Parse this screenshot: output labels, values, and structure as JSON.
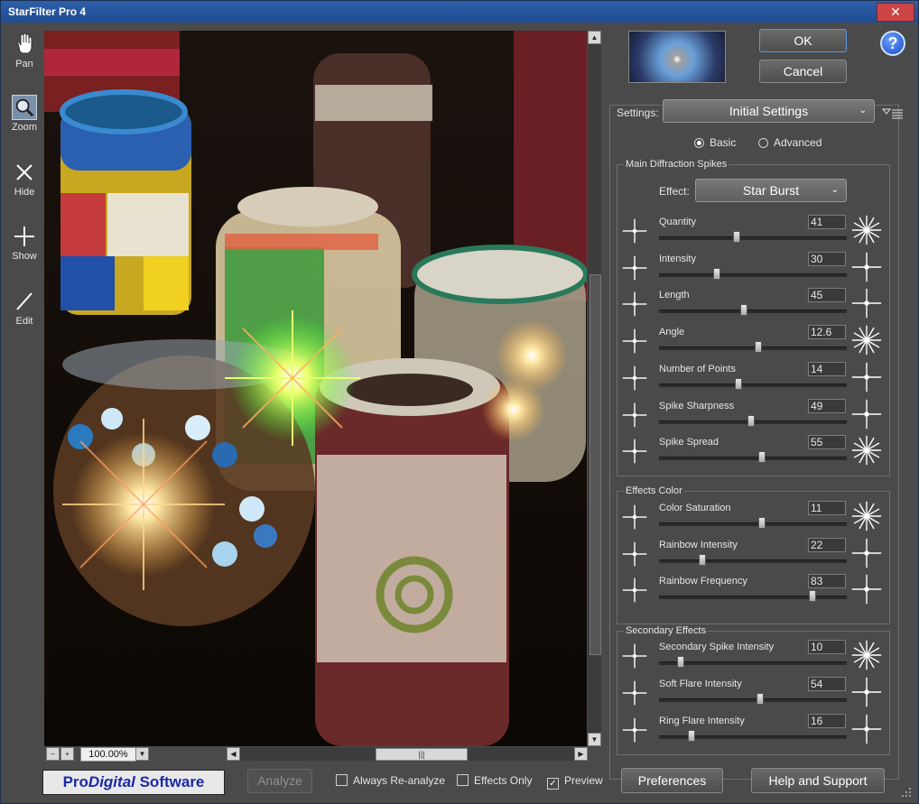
{
  "window": {
    "title": "StarFilter Pro 4"
  },
  "tools": [
    {
      "label": "Pan",
      "icon": "hand-icon"
    },
    {
      "label": "Zoom",
      "icon": "magnifier-icon"
    },
    {
      "label": "Hide",
      "icon": "cross-icon"
    },
    {
      "label": "Show",
      "icon": "plus-icon"
    },
    {
      "label": "Edit",
      "icon": "pencil-icon"
    }
  ],
  "zoom": {
    "value": "100.00%"
  },
  "dialog": {
    "ok": "OK",
    "cancel": "Cancel",
    "help": "?"
  },
  "settings": {
    "label": "Settings:",
    "preset": "Initial Settings",
    "mode_basic": "Basic",
    "mode_advanced": "Advanced",
    "selected_mode": "Basic"
  },
  "main_spikes": {
    "title": "Main Diffraction Spikes",
    "effect_label": "Effect:",
    "effect_value": "Star Burst",
    "sliders": [
      {
        "name": "Quantity",
        "value": "41",
        "fraction": 0.41
      },
      {
        "name": "Intensity",
        "value": "30",
        "fraction": 0.3
      },
      {
        "name": "Length",
        "value": "45",
        "fraction": 0.45
      },
      {
        "name": "Angle",
        "value": "12.6",
        "fraction": 0.53
      },
      {
        "name": "Number of Points",
        "value": "14",
        "fraction": 0.42
      },
      {
        "name": "Spike Sharpness",
        "value": "49",
        "fraction": 0.49
      },
      {
        "name": "Spike Spread",
        "value": "55",
        "fraction": 0.55
      }
    ]
  },
  "effects_color": {
    "title": "Effects Color",
    "sliders": [
      {
        "name": "Color Saturation",
        "value": "11",
        "fraction": 0.55
      },
      {
        "name": "Rainbow Intensity",
        "value": "22",
        "fraction": 0.22
      },
      {
        "name": "Rainbow Frequency",
        "value": "83",
        "fraction": 0.83
      }
    ]
  },
  "secondary": {
    "title": "Secondary Effects",
    "sliders": [
      {
        "name": "Secondary Spike Intensity",
        "value": "10",
        "fraction": 0.1
      },
      {
        "name": "Soft Flare Intensity",
        "value": "54",
        "fraction": 0.54
      },
      {
        "name": "Ring Flare Intensity",
        "value": "16",
        "fraction": 0.16
      }
    ]
  },
  "bottom": {
    "logo_pro": "Pro",
    "logo_digital": "Digital",
    "logo_software": " Software",
    "analyze": "Analyze",
    "always_reanalyze": "Always Re-analyze",
    "effects_only": "Effects Only",
    "preview": "Preview",
    "preview_checked": true,
    "preferences": "Preferences",
    "help_support": "Help and Support"
  }
}
